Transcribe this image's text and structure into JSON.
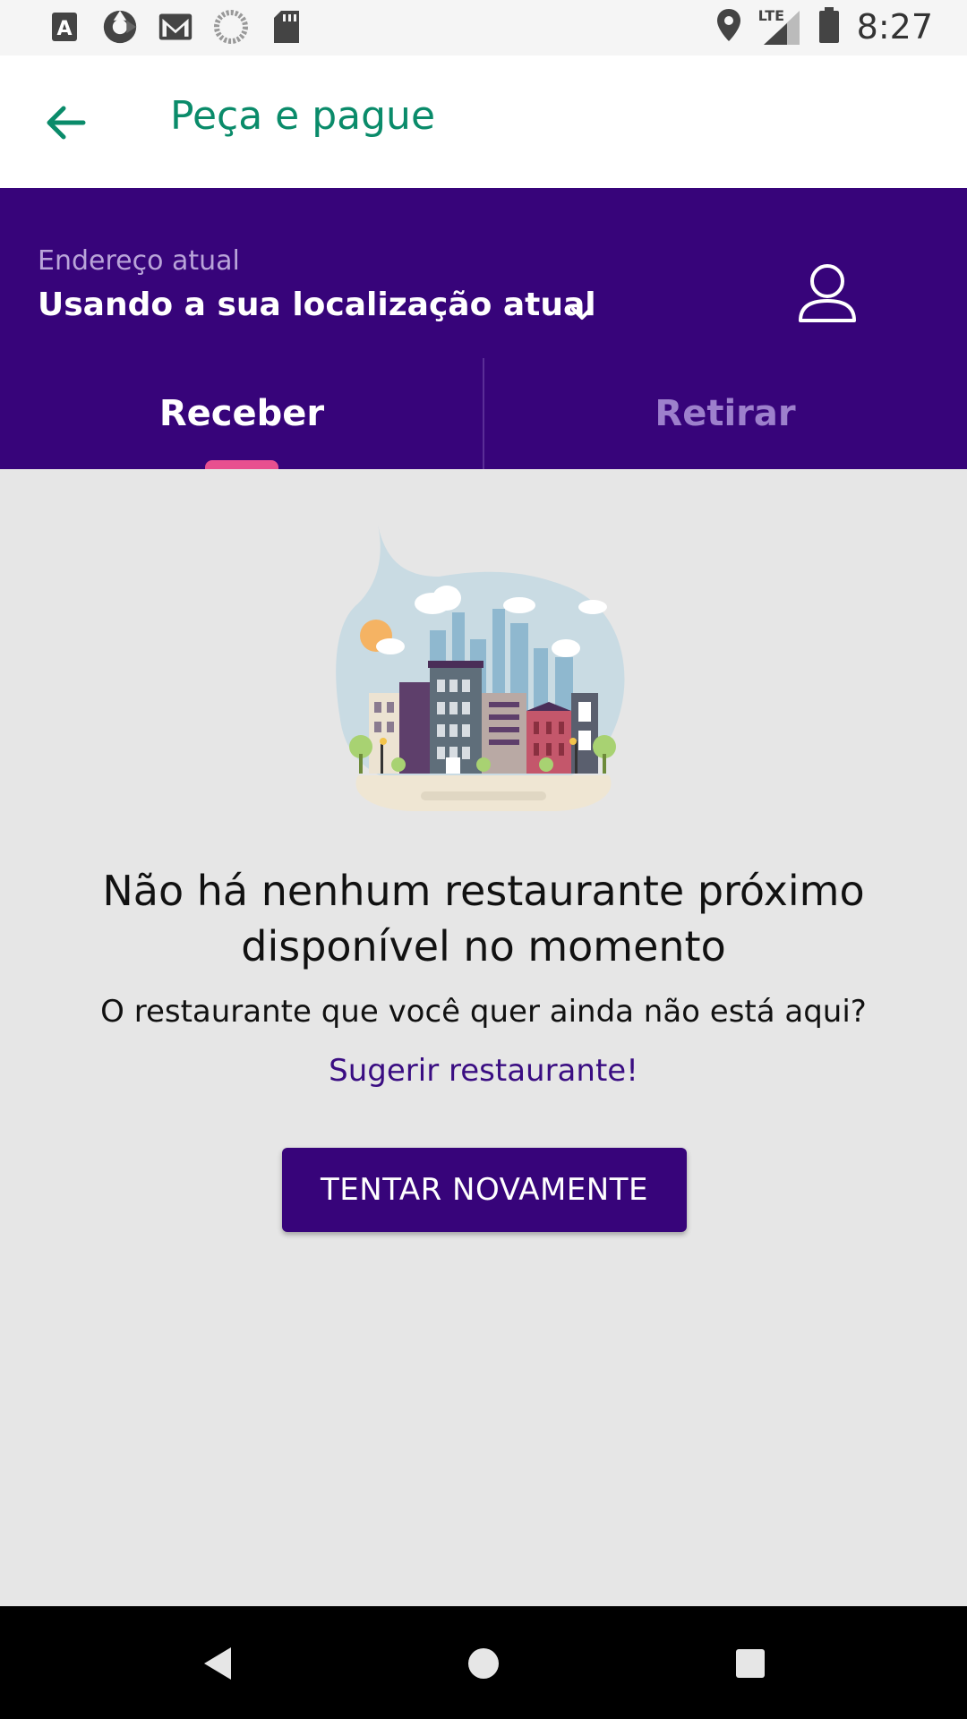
{
  "status_bar": {
    "time": "8:27",
    "network": "LTE",
    "left_icons": [
      "text-a-icon",
      "camera-shutter-icon",
      "gmail-icon",
      "circle-progress-icon",
      "sd-card-icon"
    ],
    "right_icons": [
      "location-icon",
      "signal-icon",
      "battery-icon"
    ]
  },
  "app_bar": {
    "title": "Peça e pague",
    "back_icon": "arrow-left-icon",
    "title_color": "#0a8b6a"
  },
  "address": {
    "label": "Endereço atual",
    "value": "Usando a sua localização atual",
    "chevron_icon": "chevron-down-icon",
    "profile_icon": "user-icon"
  },
  "tabs": [
    {
      "label": "Receber",
      "active": true
    },
    {
      "label": "Retirar",
      "active": false
    }
  ],
  "empty_state": {
    "illustration": "city-buildings-illustration",
    "title": "Não há nenhum restaurante próximo disponível no momento",
    "subtitle": "O restaurante que você quer ainda não está aqui?",
    "link": "Sugerir restaurante!",
    "button": "TENTAR NOVAMENTE"
  },
  "colors": {
    "primary_purple": "#37047a",
    "accent_pink": "#e8508f",
    "green": "#0a8b6a",
    "background": "#e6e6e6"
  },
  "nav_bar": {
    "icons": [
      "back-triangle-icon",
      "home-circle-icon",
      "recents-square-icon"
    ]
  }
}
